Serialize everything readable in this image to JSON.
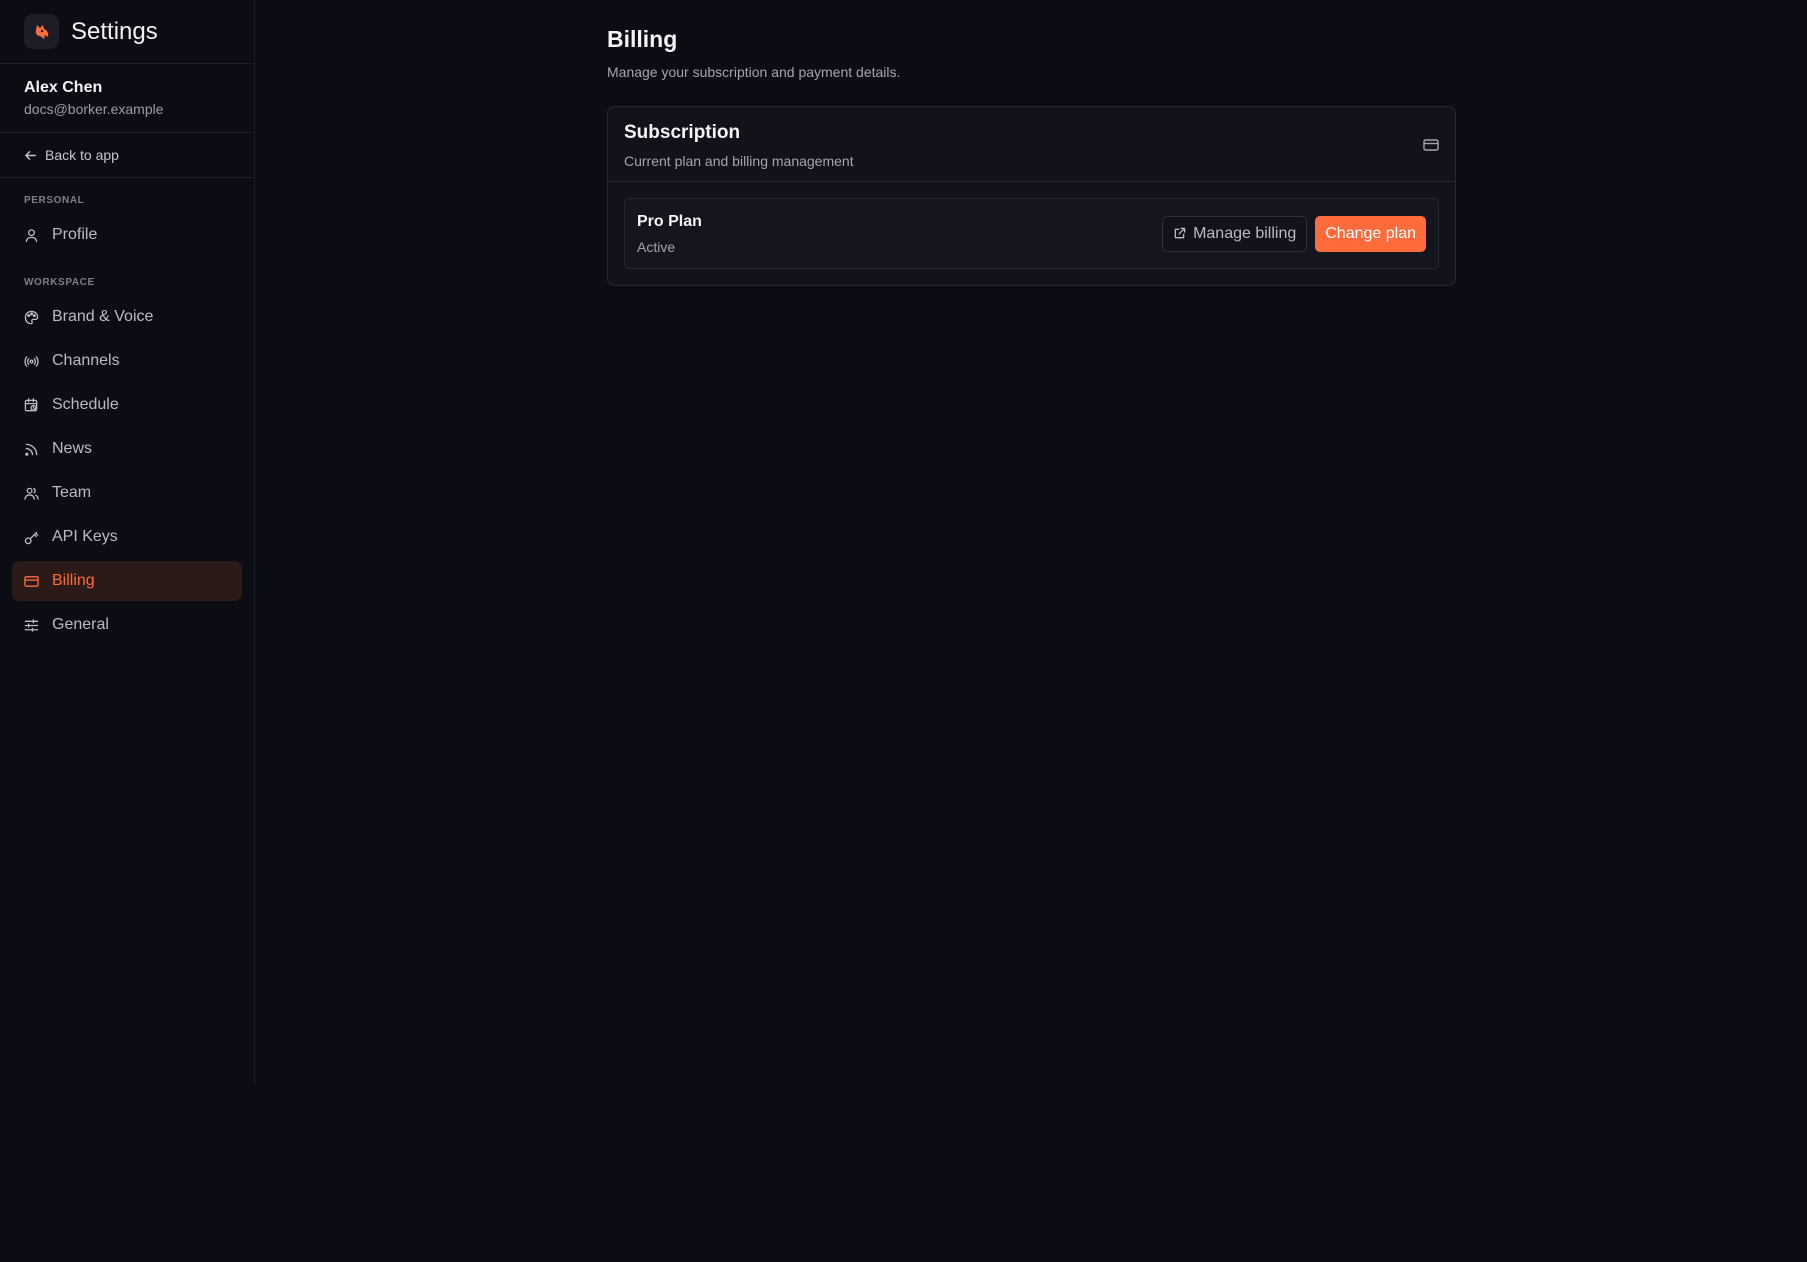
{
  "sidebar": {
    "title": "Settings",
    "user": {
      "name": "Alex Chen",
      "email": "docs@borker.example"
    },
    "back_label": "Back to app",
    "sections": {
      "personal": "PERSONAL",
      "workspace": "WORKSPACE"
    },
    "items": [
      {
        "label": "Profile",
        "icon": "user-icon"
      },
      {
        "label": "Brand & Voice",
        "icon": "palette-icon"
      },
      {
        "label": "Channels",
        "icon": "radio-icon"
      },
      {
        "label": "Schedule",
        "icon": "calendar-clock-icon"
      },
      {
        "label": "News",
        "icon": "rss-icon"
      },
      {
        "label": "Team",
        "icon": "users-icon"
      },
      {
        "label": "API Keys",
        "icon": "key-icon"
      },
      {
        "label": "Billing",
        "icon": "credit-card-icon",
        "active": true
      },
      {
        "label": "General",
        "icon": "sliders-icon"
      }
    ]
  },
  "main": {
    "title": "Billing",
    "subtitle": "Manage your subscription and payment details.",
    "card": {
      "title": "Subscription",
      "subtitle": "Current plan and billing management",
      "plan": {
        "name": "Pro Plan",
        "status": "Active"
      },
      "manage_label": "Manage billing",
      "change_label": "Change plan"
    }
  },
  "colors": {
    "accent": "#ff6b3a",
    "background": "#0c0d14",
    "card": "#11121a",
    "active_bg": "#2a1a18"
  }
}
